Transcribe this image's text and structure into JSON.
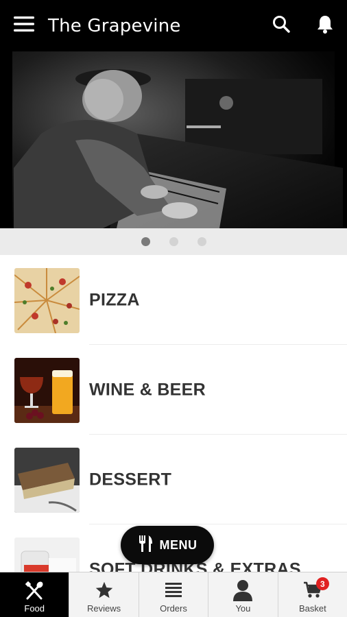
{
  "app": {
    "title": "The Grapevine"
  },
  "header": {
    "menu_icon": "hamburger-icon",
    "search_icon": "search-icon",
    "notifications_icon": "bell-icon"
  },
  "carousel": {
    "slide_count": 3,
    "active_index": 0
  },
  "categories": [
    {
      "label": "PIZZA",
      "icon": "pizza-thumbnail"
    },
    {
      "label": "WINE & BEER",
      "icon": "wine-beer-thumbnail"
    },
    {
      "label": "DESSERT",
      "icon": "dessert-thumbnail"
    },
    {
      "label": "SOFT DRINKS & EXTRAS",
      "icon": "soft-drinks-thumbnail"
    }
  ],
  "fab": {
    "label": "MENU",
    "icon": "fork-knife-icon"
  },
  "bottom_nav": [
    {
      "label": "Food",
      "icon": "fork-spoon-icon",
      "active": true
    },
    {
      "label": "Reviews",
      "icon": "star-icon",
      "active": false
    },
    {
      "label": "Orders",
      "icon": "list-icon",
      "active": false
    },
    {
      "label": "You",
      "icon": "person-icon",
      "active": false
    },
    {
      "label": "Basket",
      "icon": "cart-icon",
      "active": false,
      "badge": "3"
    }
  ],
  "colors": {
    "header_bg": "#000000",
    "active_nav_bg": "#000000",
    "badge": "#e02020",
    "label_text": "#333333"
  }
}
